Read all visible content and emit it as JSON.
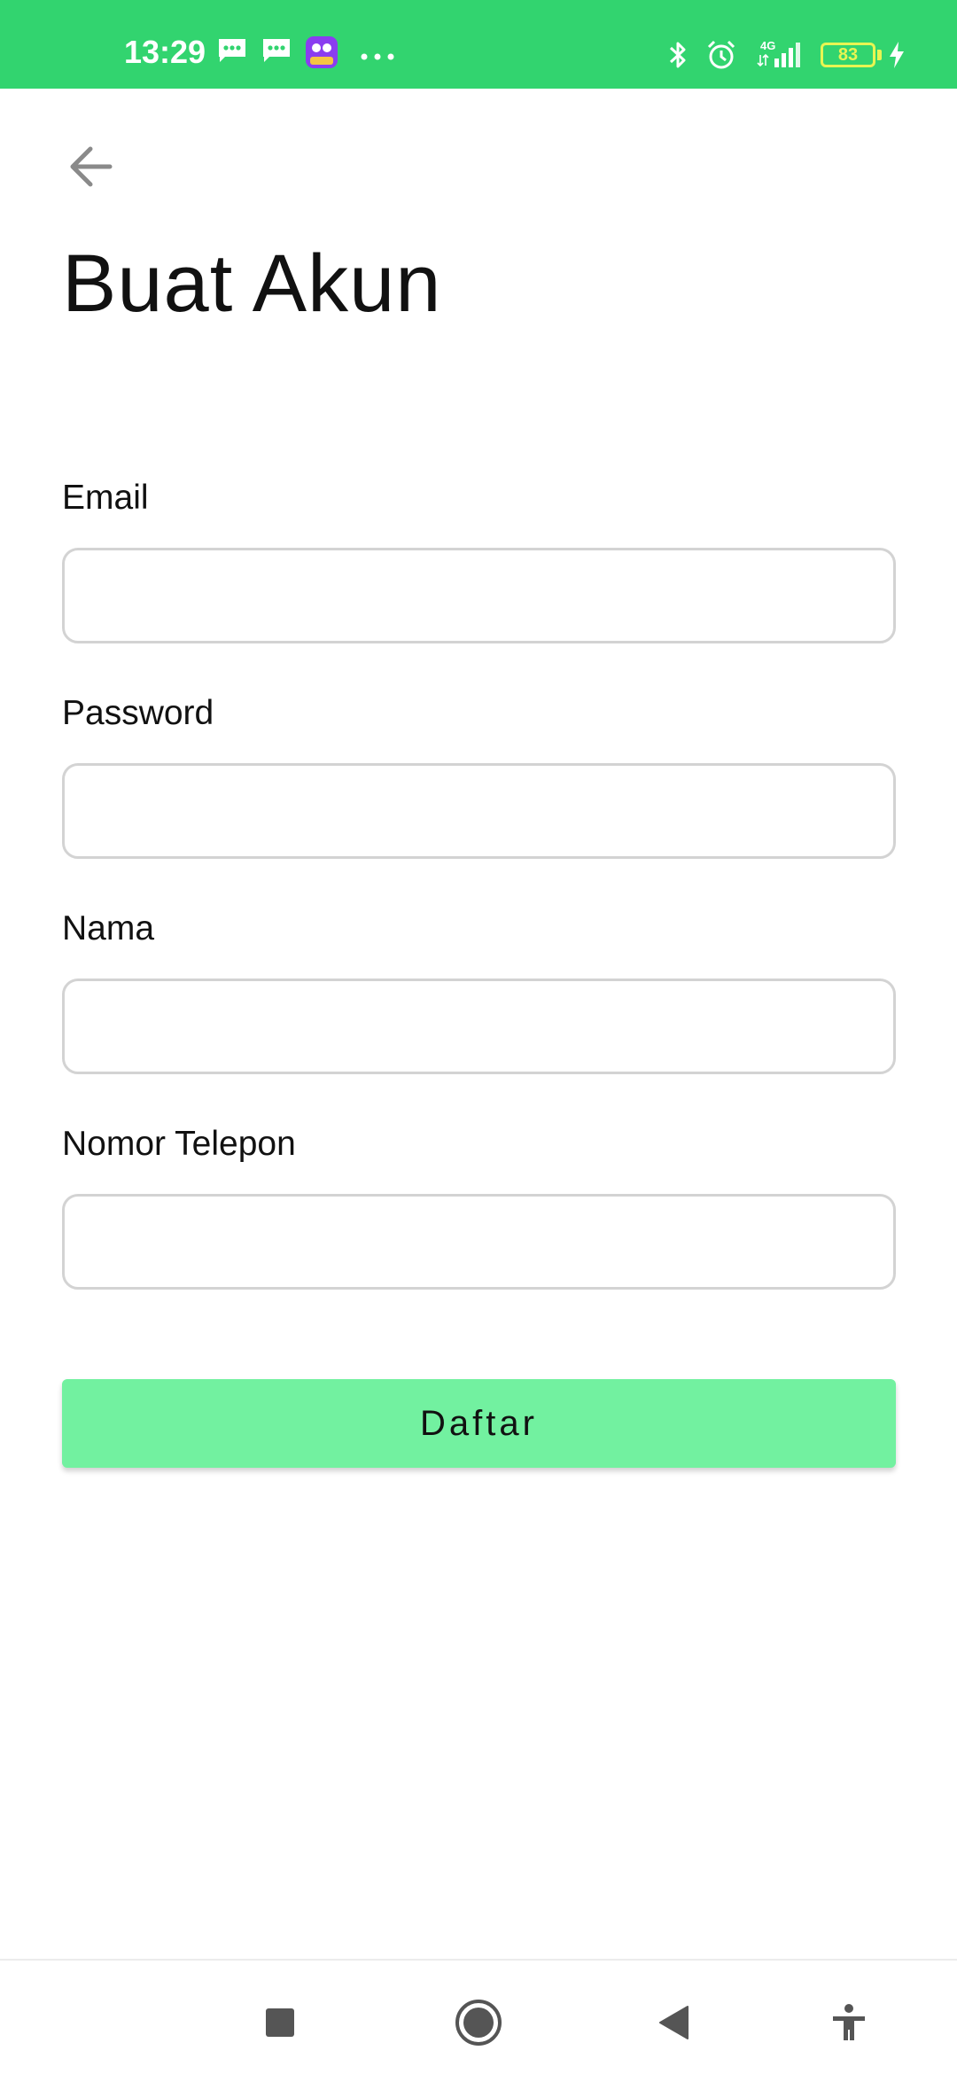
{
  "status_bar": {
    "time": "13:29",
    "network": "4G",
    "battery": "83",
    "background_color": "#32d46f"
  },
  "header": {
    "back_icon": "arrow-left-icon",
    "title": "Buat Akun"
  },
  "form": {
    "fields": [
      {
        "label": "Email",
        "value": "",
        "placeholder": ""
      },
      {
        "label": "Password",
        "value": "",
        "placeholder": ""
      },
      {
        "label": "Nama",
        "value": "",
        "placeholder": ""
      },
      {
        "label": "Nomor Telepon",
        "value": "",
        "placeholder": ""
      }
    ],
    "submit_label": "Daftar",
    "submit_color": "#72f1a0"
  },
  "nav_bar": {
    "icons": [
      "recent-apps-icon",
      "home-icon",
      "back-triangle-icon",
      "accessibility-icon"
    ]
  }
}
